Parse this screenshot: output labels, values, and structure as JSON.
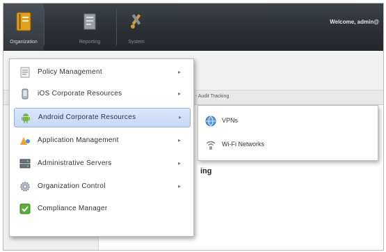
{
  "toolbar": {
    "items": [
      {
        "label": "Organization",
        "icon": "organization-book-icon"
      },
      {
        "label": "Reporting",
        "icon": "reporting-document-icon"
      },
      {
        "label": "System",
        "icon": "system-tools-icon"
      }
    ],
    "welcome": "Welcome, admin@"
  },
  "breadcrumb": "- Audit Tracking",
  "content_heading_fragment": "ing",
  "menu": {
    "items": [
      {
        "label": "Policy Management",
        "icon": "policy-document-icon",
        "has_submenu": true
      },
      {
        "label": "iOS Corporate Resources",
        "icon": "ios-device-icon",
        "has_submenu": true
      },
      {
        "label": "Android Corporate Resources",
        "icon": "android-robot-icon",
        "has_submenu": true,
        "highlighted": true
      },
      {
        "label": "Application Management",
        "icon": "application-shapes-icon",
        "has_submenu": true
      },
      {
        "label": "Administrative Servers",
        "icon": "servers-icon",
        "has_submenu": true
      },
      {
        "label": "Organization Control",
        "icon": "organization-gear-icon",
        "has_submenu": true
      },
      {
        "label": "Compliance Manager",
        "icon": "compliance-check-icon",
        "has_submenu": false
      }
    ],
    "arrow_glyph": "▸"
  },
  "submenu": {
    "items": [
      {
        "label": "VPNs",
        "icon": "vpn-globe-icon"
      },
      {
        "label": "Wi-Fi Networks",
        "icon": "wifi-network-icon"
      }
    ]
  },
  "colors": {
    "toolbar_bg": "#2a2e33",
    "highlight_bg": "#c5d8f5",
    "highlight_border": "#8fb0de"
  }
}
